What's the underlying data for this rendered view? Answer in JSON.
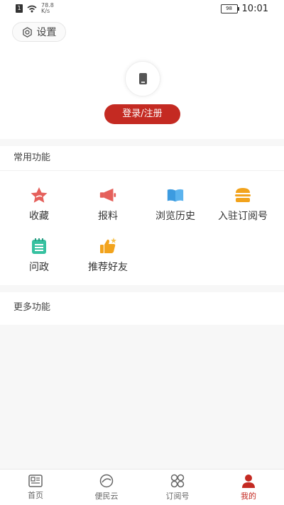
{
  "status_bar": {
    "net_speed_value": "78.8",
    "net_speed_unit": "K/s",
    "battery": "98",
    "time": "10:01"
  },
  "header": {
    "settings_label": "设置",
    "login_label": "登录/注册"
  },
  "common_functions": {
    "title": "常用功能",
    "items": [
      {
        "label": "收藏",
        "icon": "star-icon",
        "color": "#e5605b"
      },
      {
        "label": "报料",
        "icon": "megaphone-icon",
        "color": "#e5605b"
      },
      {
        "label": "浏览历史",
        "icon": "book-icon",
        "color": "#3c9be0"
      },
      {
        "label": "入驻订阅号",
        "icon": "burger-icon",
        "color": "#f2a31c"
      },
      {
        "label": "问政",
        "icon": "notepad-icon",
        "color": "#36c1a0"
      },
      {
        "label": "推荐好友",
        "icon": "thumbs-up-icon",
        "color": "#f2a31c"
      }
    ]
  },
  "more_functions": {
    "title": "更多功能"
  },
  "tabbar": {
    "tabs": [
      {
        "label": "首页",
        "icon": "news-icon"
      },
      {
        "label": "便民云",
        "icon": "cloud-icon"
      },
      {
        "label": "订阅号",
        "icon": "grid-icon"
      },
      {
        "label": "我的",
        "icon": "user-icon"
      }
    ],
    "active_index": 3,
    "active_color": "#c42a22"
  }
}
